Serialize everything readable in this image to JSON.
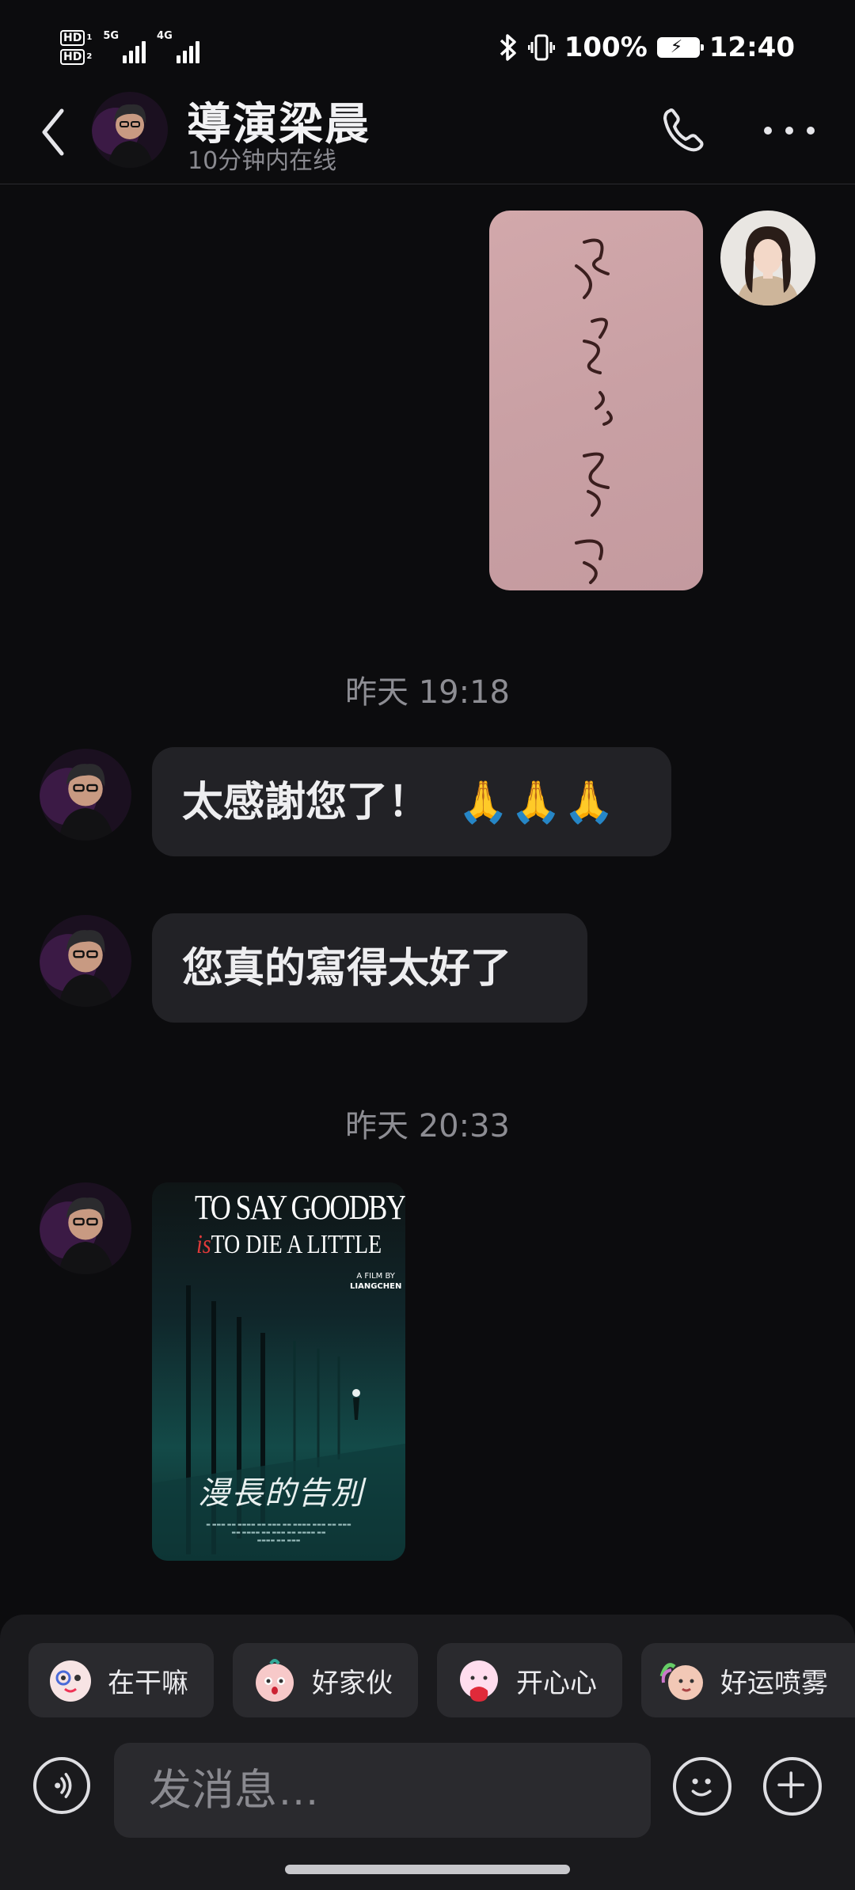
{
  "status_bar": {
    "hd1": "HD",
    "hd1_sub": "1",
    "hd2": "HD",
    "hd2_sub": "2",
    "net1": "5G",
    "net2": "4G",
    "battery_percent": "100%",
    "time": "12:40"
  },
  "header": {
    "contact_name": "導演梁晨",
    "contact_status": "10分钟内在线"
  },
  "messages": {
    "ts1": "昨天 19:18",
    "msg1": "太感謝您了！",
    "msg1_emoji": "🙏🙏🙏",
    "msg2": "您真的寫得太好了",
    "ts2": "昨天 20:33"
  },
  "poster": {
    "title": "TO SAY GOODBYE",
    "is": "is",
    "subtitle": "TO DIE A LITTLE",
    "credit_top": "A FILM BY",
    "credit_name": "LIANGCHEN",
    "cn_title": "漫長的告別"
  },
  "stickers": [
    {
      "label": "在干嘛"
    },
    {
      "label": "好家伙"
    },
    {
      "label": "开心心"
    },
    {
      "label": "好运喷雾"
    }
  ],
  "composer": {
    "placeholder": "发消息…"
  },
  "colors": {
    "background": "#0c0c0e",
    "bubble": "#222226",
    "timestamp": "#8d8d93"
  }
}
